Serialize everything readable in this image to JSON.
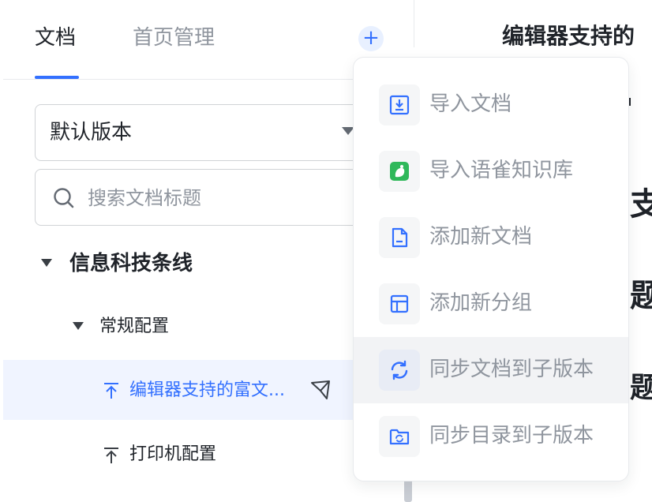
{
  "tabs": {
    "docs": "文档",
    "home_manage": "首页管理",
    "add_symbol": "+"
  },
  "doc_title": "编辑器支持的",
  "peek_chars": [
    "支",
    "题",
    "题"
  ],
  "version_select": {
    "value": "默认版本"
  },
  "search": {
    "placeholder": "搜索文档标题"
  },
  "tree": {
    "group": "信息科技条线",
    "subgroup": "常规配置",
    "items": [
      {
        "label": "编辑器支持的富文...",
        "active": true
      },
      {
        "label": "打印机配置",
        "active": false
      }
    ]
  },
  "menu": {
    "items": [
      {
        "label": "导入文档",
        "icon": "import-doc-icon"
      },
      {
        "label": "导入语雀知识库",
        "icon": "yuque-icon"
      },
      {
        "label": "添加新文档",
        "icon": "new-doc-icon"
      },
      {
        "label": "添加新分组",
        "icon": "new-group-icon"
      },
      {
        "label": "同步文档到子版本",
        "icon": "sync-icon"
      },
      {
        "label": "同步目录到子版本",
        "icon": "sync-folder-icon"
      }
    ]
  },
  "colors": {
    "accent": "#3370ff",
    "active_bg": "#f0f4ff",
    "muted_text": "#8f959e",
    "yuque_green": "#2fb85a"
  }
}
